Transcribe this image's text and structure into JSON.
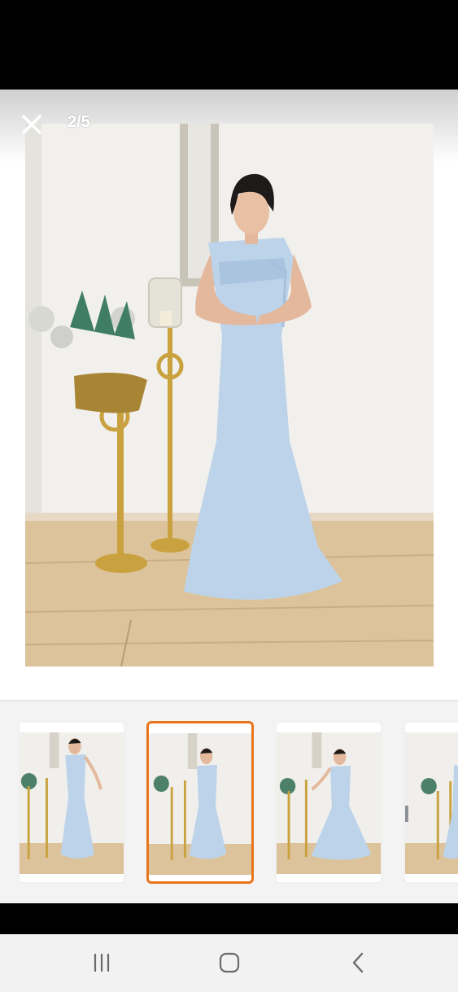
{
  "viewer": {
    "counter": "2/5",
    "close_icon": "close-icon"
  },
  "photo": {
    "description_icon": "dress-photo",
    "dress_color": "#bcd3ea",
    "wall_color": "#f0efeb",
    "floor_color": "#dcc39b",
    "brass_color": "#c9a23f"
  },
  "thumbnails": {
    "count": 5,
    "selected_index": 1,
    "accent": "#e8741c"
  },
  "navigation": {
    "recents_icon": "recents-icon",
    "home_icon": "home-icon",
    "back_icon": "back-icon"
  }
}
